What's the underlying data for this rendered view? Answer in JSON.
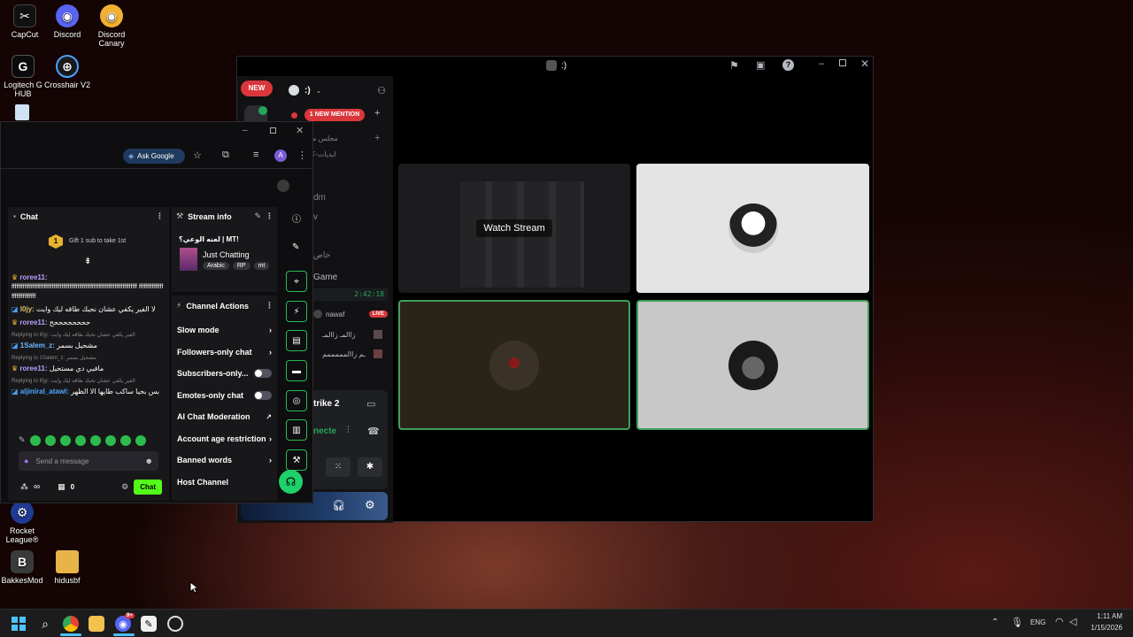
{
  "desktop": {
    "icons": [
      {
        "label": "CapCut",
        "glyph": "✂",
        "color": "#111111"
      },
      {
        "label": "Discord",
        "glyph": "◉",
        "color": "#5865f2"
      },
      {
        "label": "Discord Canary",
        "glyph": "◉",
        "color": "#f0b132"
      },
      {
        "label": "Logitech G HUB",
        "glyph": "G",
        "color": "#0b0b0b"
      },
      {
        "label": "Crosshair V2",
        "glyph": "⊕",
        "color": "#1a1a1a"
      },
      {
        "label": "Rocket League®",
        "glyph": "⚙",
        "color": "#1f3a93"
      },
      {
        "label": "BakkesMod",
        "glyph": "B",
        "color": "#3a3a3a"
      },
      {
        "label": "hidusbf",
        "glyph": "▬",
        "color": "#e8b44a"
      }
    ]
  },
  "discord": {
    "title": ":)",
    "new_badge": "NEW",
    "server_name": ":)",
    "mention_badge": "1 NEW MENTION",
    "channel_category": "مجلس مافيا",
    "channels": [
      "ايديات-كنت",
      "t",
      "dm",
      "v",
      "خاص",
      "Game"
    ],
    "timer": "2:42:18",
    "voice_users": [
      {
        "name": "nawaf",
        "live": "LIVE"
      },
      {
        "name": "زاالمـ زاالمـ",
        "live": ""
      },
      {
        "name": "ـم زاالمممممم",
        "live": ""
      }
    ],
    "activity": "trike 2",
    "connected": "necte",
    "watch_stream": "Watch Stream"
  },
  "browser": {
    "ask_google": "Ask Google",
    "profile_initial": "A",
    "chat": {
      "title": "Chat",
      "gift_text": "Gift 1 sub to take 1st",
      "gift_rank": "1",
      "messages": [
        {
          "user": "roree11:",
          "text": "ffffffffffffffffffffffffffffffffffffffffffffffffffffffffffffffffffffffffffffff ffffffffffffffffffffffffffffff",
          "color": "#b9a0ff",
          "reply": ""
        },
        {
          "user": "l0jy:",
          "text": "لا الفير يكفي عشان نحبك طاقه ليك وايت",
          "color": "#d9c46a",
          "reply": ""
        },
        {
          "user": "roree11:",
          "text": "ححححححححح",
          "color": "#b9a0ff",
          "reply": ""
        },
        {
          "user": "1Salem_z:",
          "text": "مشحيل بسمر",
          "color": "#6fb7ff",
          "reply": "Replying to l0jy: الفير يكفي عشان نحبك طاقه ليك وايت"
        },
        {
          "user": "roree11:",
          "text": "مافيي دي مستحيل",
          "color": "#b9a0ff",
          "reply": "Replying to 1Salem_z: مشحيل بسمر"
        },
        {
          "user": "aljiniral_atawl:",
          "text": "بس بحيا ساكب طايها الا الظهر",
          "color": "#4fa8ff",
          "reply": "Replying to l0jy: الفير يكفي عشان نحبك طاقه ليك وايت"
        }
      ],
      "input_placeholder": "Send a message",
      "followers_count": "∞",
      "points": "0",
      "send_button": "Chat"
    },
    "stream_info": {
      "title": "Stream info",
      "stream_title": "لعنه الوعي؟ | MT!",
      "category": "Just Chatting",
      "tags": [
        "Arabic",
        "RP",
        "mt"
      ]
    },
    "channel_actions": {
      "title": "Channel Actions",
      "items": [
        {
          "label": "Slow mode",
          "kind": "chevron"
        },
        {
          "label": "Followers-only chat",
          "kind": "chevron"
        },
        {
          "label": "Subscribers-only...",
          "kind": "toggle"
        },
        {
          "label": "Emotes-only chat",
          "kind": "toggle"
        },
        {
          "label": "AI Chat Moderation",
          "kind": "external"
        },
        {
          "label": "Account age restriction",
          "kind": "chevron"
        },
        {
          "label": "Banned words",
          "kind": "chevron"
        },
        {
          "label": "Host Channel",
          "kind": "none"
        }
      ]
    }
  },
  "taskbar": {
    "language": "ENG",
    "time": "1:11 AM",
    "date": "1/15/2026",
    "discord_badge": "9+"
  },
  "colors": {
    "twitch_green": "#53fc18",
    "discord_red": "#da373c",
    "mod_green": "#2dba4e"
  }
}
